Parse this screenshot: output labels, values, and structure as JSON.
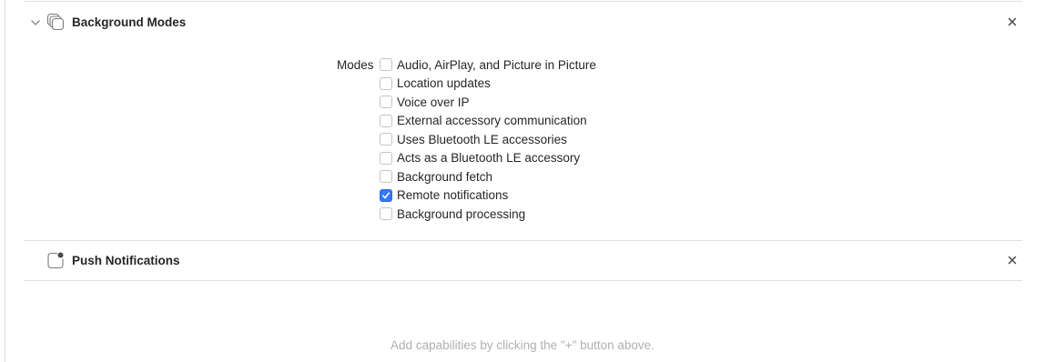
{
  "sections": [
    {
      "title": "Background Modes",
      "icon": "background-modes-icon",
      "expanded": true,
      "modes_label": "Modes",
      "modes": [
        {
          "label": "Audio, AirPlay, and Picture in Picture",
          "checked": false
        },
        {
          "label": "Location updates",
          "checked": false
        },
        {
          "label": "Voice over IP",
          "checked": false
        },
        {
          "label": "External accessory communication",
          "checked": false
        },
        {
          "label": "Uses Bluetooth LE accessories",
          "checked": false
        },
        {
          "label": "Acts as a Bluetooth LE accessory",
          "checked": false
        },
        {
          "label": "Background fetch",
          "checked": false
        },
        {
          "label": "Remote notifications",
          "checked": true
        },
        {
          "label": "Background processing",
          "checked": false
        }
      ]
    },
    {
      "title": "Push Notifications",
      "icon": "push-notifications-icon"
    }
  ],
  "hint": "Add capabilities by clicking the \"+\" button above.",
  "colors": {
    "accent": "#3478f6",
    "divider": "#e0e0e0",
    "hint_text": "#b0b0b0"
  }
}
